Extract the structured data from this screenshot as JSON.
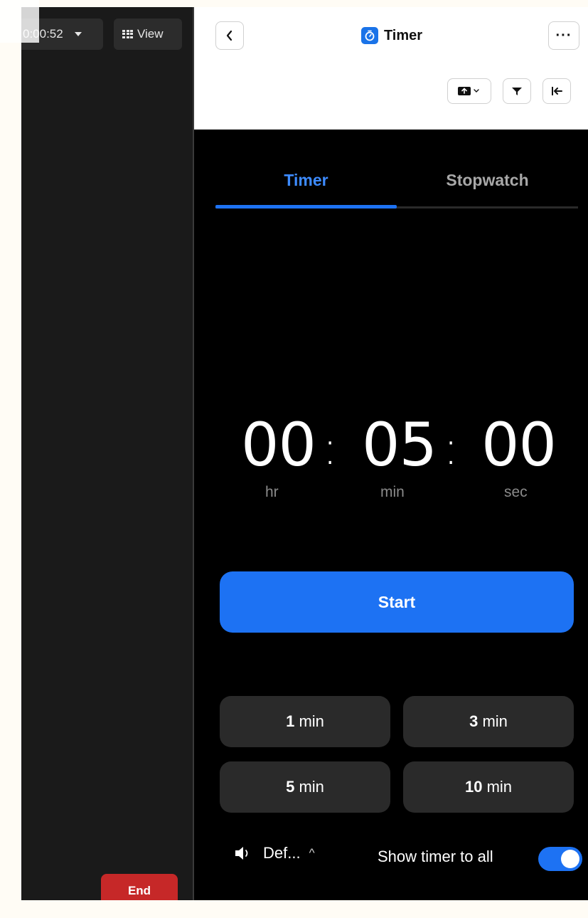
{
  "meeting": {
    "elapsed": "0:00:52",
    "view_label": "View",
    "end_label": "End"
  },
  "panel": {
    "title": "Timer",
    "more": "···",
    "tabs": [
      {
        "label": "Timer",
        "active": true
      },
      {
        "label": "Stopwatch",
        "active": false
      }
    ],
    "clock": {
      "hours": "00",
      "minutes": "05",
      "seconds": "00",
      "separator": ":",
      "hr_unit": "hr",
      "min_unit": "min",
      "sec_unit": "sec"
    },
    "start_label": "Start",
    "presets": [
      {
        "num": "1",
        "unit": "min"
      },
      {
        "num": "3",
        "unit": "min"
      },
      {
        "num": "5",
        "unit": "min"
      },
      {
        "num": "10",
        "unit": "min"
      }
    ],
    "footer": {
      "sound_label": "Def...",
      "show_label": "Show timer to all",
      "show_enabled": true
    }
  },
  "colors": {
    "accent": "#1d72f3",
    "end": "#c62828",
    "panel_bg": "#000000",
    "meeting_bg": "#1a1a1a"
  },
  "icons": [
    "grid-icon",
    "chevron-left-icon",
    "stopwatch-icon",
    "more-icon",
    "share-screen-icon",
    "filter-icon",
    "collapse-icon",
    "speaker-icon",
    "chevron-up-icon"
  ]
}
